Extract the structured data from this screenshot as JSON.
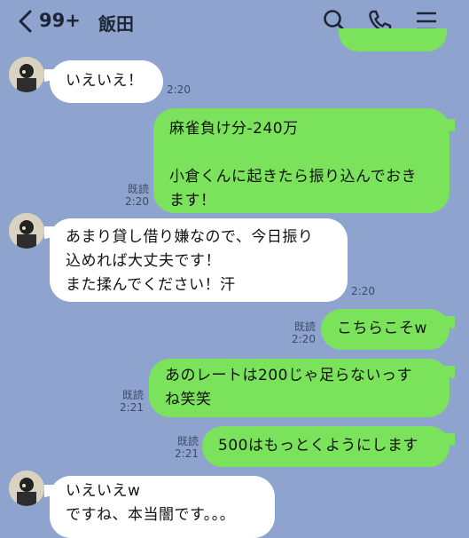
{
  "header": {
    "back_count": "99+",
    "contact_name": "飯田"
  },
  "icons": {
    "back": "chevron-left-icon",
    "search": "search-icon",
    "call": "phone-icon",
    "menu": "menu-icon"
  },
  "colors": {
    "background": "#8ea4cf",
    "outgoing_bubble": "#7be25c",
    "incoming_bubble": "#ffffff"
  },
  "messages": [
    {
      "dir": "in",
      "text": "いえいえ！",
      "time": "2:20"
    },
    {
      "dir": "out",
      "text": "麻雀負け分-240万\n\n小倉くんに起きたら振り込んでおき\nます！",
      "read": "既読",
      "time": "2:20"
    },
    {
      "dir": "in",
      "text": "あまり貸し借り嫌なので、今日振り\n込めれば大丈夫です！\nまた揉んでください！汗",
      "time": "2:20"
    },
    {
      "dir": "out",
      "text": "こちらこそw",
      "read": "既読",
      "time": "2:20"
    },
    {
      "dir": "out",
      "text": "あのレートは200じゃ足らないっす\nね笑笑",
      "read": "既読",
      "time": "2:21"
    },
    {
      "dir": "out",
      "text": "500はもっとくようにします",
      "read": "既読",
      "time": "2:21"
    },
    {
      "dir": "in",
      "text": "いえいえw\nですね、本当闇です。。。",
      "time": ""
    }
  ]
}
